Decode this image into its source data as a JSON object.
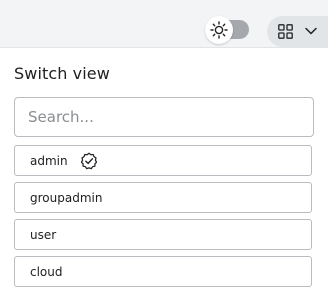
{
  "panel": {
    "title": "Switch view",
    "search_placeholder": "Search...",
    "search_value": ""
  },
  "users": [
    {
      "label": "admin",
      "active": true
    },
    {
      "label": "groupadmin",
      "active": false
    },
    {
      "label": "user",
      "active": false
    },
    {
      "label": "cloud",
      "active": false
    }
  ],
  "icons": {
    "theme": "sun-icon",
    "view_switch": "grid-icon",
    "dropdown": "chevron-down-icon",
    "active_user": "verified-badge-icon"
  }
}
